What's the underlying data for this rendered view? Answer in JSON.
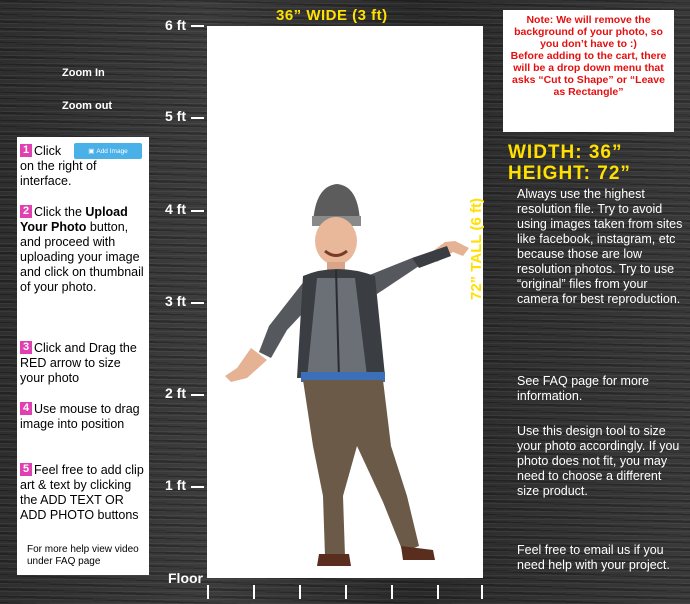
{
  "ruler": {
    "ticks": [
      "6 ft",
      "5 ft",
      "4 ft",
      "3 ft",
      "2 ft",
      "1 ft"
    ],
    "floor": "Floor"
  },
  "canvas": {
    "width_label": "36” WIDE (3 ft)",
    "height_label": "72” TALL (6 ft)"
  },
  "zoom": {
    "in": "Zoom In",
    "out": "Zoom out"
  },
  "instructions": {
    "step1": {
      "num": "1",
      "pre": "Click",
      "post": "on the right of interface.",
      "button": "Add Image"
    },
    "step2": {
      "num": "2",
      "pre": "Click the ",
      "bold": "Upload Your Photo",
      "post": " button, and proceed with uploading your image and click on thumbnail of your photo."
    },
    "step3": {
      "num": "3",
      "text": "Click and Drag the RED arrow to size your photo"
    },
    "step4": {
      "num": "4",
      "text": "Use mouse to drag image into position"
    },
    "step5": {
      "num": "5",
      "text": "Feel free to add clip art & text by clicking the ADD TEXT OR ADD PHOTO buttons"
    },
    "help": "For more help view video under FAQ page"
  },
  "note": {
    "line1": "Note: We will remove the background of your photo, so you don’t have to :)",
    "line2": "Before adding to the cart, there will be a drop down menu that asks “Cut to Shape” or “Leave as Rectangle”"
  },
  "dimensions": {
    "width": "WIDTH: 36”",
    "height": "HEIGHT: 72”"
  },
  "tips": {
    "p1": "Always use the highest resolution file. Try to avoid using images taken from sites like facebook, instagram, etc because those are low resolution photos. Try to use “original” files from your camera for best reproduction.",
    "p2": "See FAQ page for more information.",
    "p3": "Use this design tool to size your photo accordingly.  If you photo does not fit, you may need to choose a different size product.",
    "p4": "Feel free to email us if you need help with your project."
  },
  "colors": {
    "accent_yellow": "#ffe000",
    "note_red": "#e41010",
    "step_pink": "#e040b0",
    "button_blue": "#4ab0e8"
  }
}
